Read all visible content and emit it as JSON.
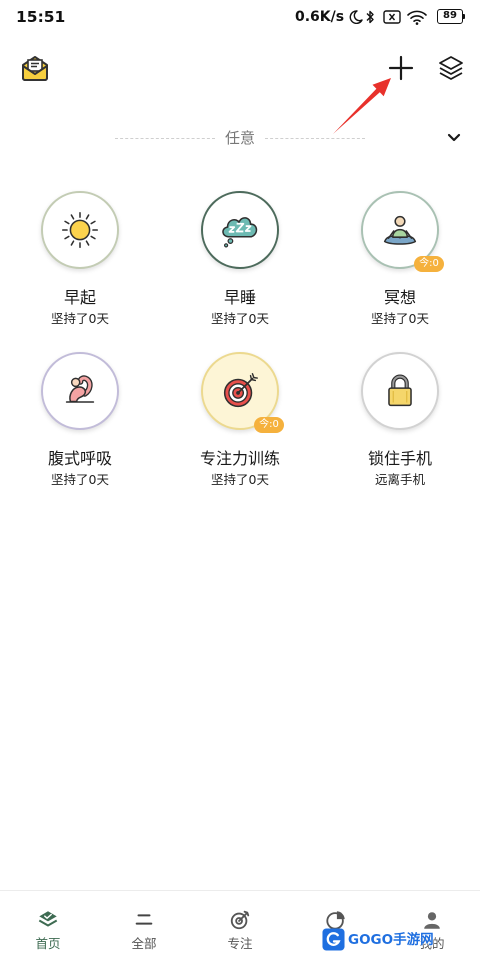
{
  "status_bar": {
    "time": "15:51",
    "net_speed": "0.6K/s",
    "battery": "89",
    "icons": [
      "moon-icon",
      "bluetooth-icon",
      "no-sim-icon",
      "wifi-icon",
      "battery-icon"
    ]
  },
  "header": {
    "left_icon": "mail-icon",
    "right_icons": [
      "plus-icon",
      "layers-icon"
    ]
  },
  "filter": {
    "label": "任意",
    "icon": "chevron-down-icon"
  },
  "habits": [
    {
      "title": "早起",
      "subtitle": "坚持了0天",
      "icon": "sun-icon"
    },
    {
      "title": "早睡",
      "subtitle": "坚持了0天",
      "icon": "sleep-cloud-icon"
    },
    {
      "title": "冥想",
      "subtitle": "坚持了0天",
      "icon": "meditation-icon",
      "badge": "今:0"
    },
    {
      "title": "腹式呼吸",
      "subtitle": "坚持了0天",
      "icon": "yoga-icon"
    },
    {
      "title": "专注力训练",
      "subtitle": "坚持了0天",
      "icon": "target-icon",
      "badge": "今:0"
    },
    {
      "title": "锁住手机",
      "subtitle": "远离手机",
      "icon": "lock-icon"
    }
  ],
  "bottom_nav": {
    "tabs": [
      {
        "label": "首页",
        "icon": "home-icon",
        "active": true
      },
      {
        "label": "全部",
        "icon": "list-icon",
        "active": false
      },
      {
        "label": "专注",
        "icon": "focus-icon",
        "active": false
      },
      {
        "icon": "pie-chart-icon",
        "active": false
      },
      {
        "label": "我的",
        "icon": "user-icon",
        "active": false
      }
    ]
  },
  "annotation": {
    "icon": "red-arrow-icon",
    "color": "#e8312b"
  },
  "watermark": {
    "text": "GOGO手游网"
  },
  "colors": {
    "accent": "#3e6b52",
    "badge": "#f5b13d",
    "text_primary": "#1a1a1a",
    "text_muted": "#777777"
  }
}
